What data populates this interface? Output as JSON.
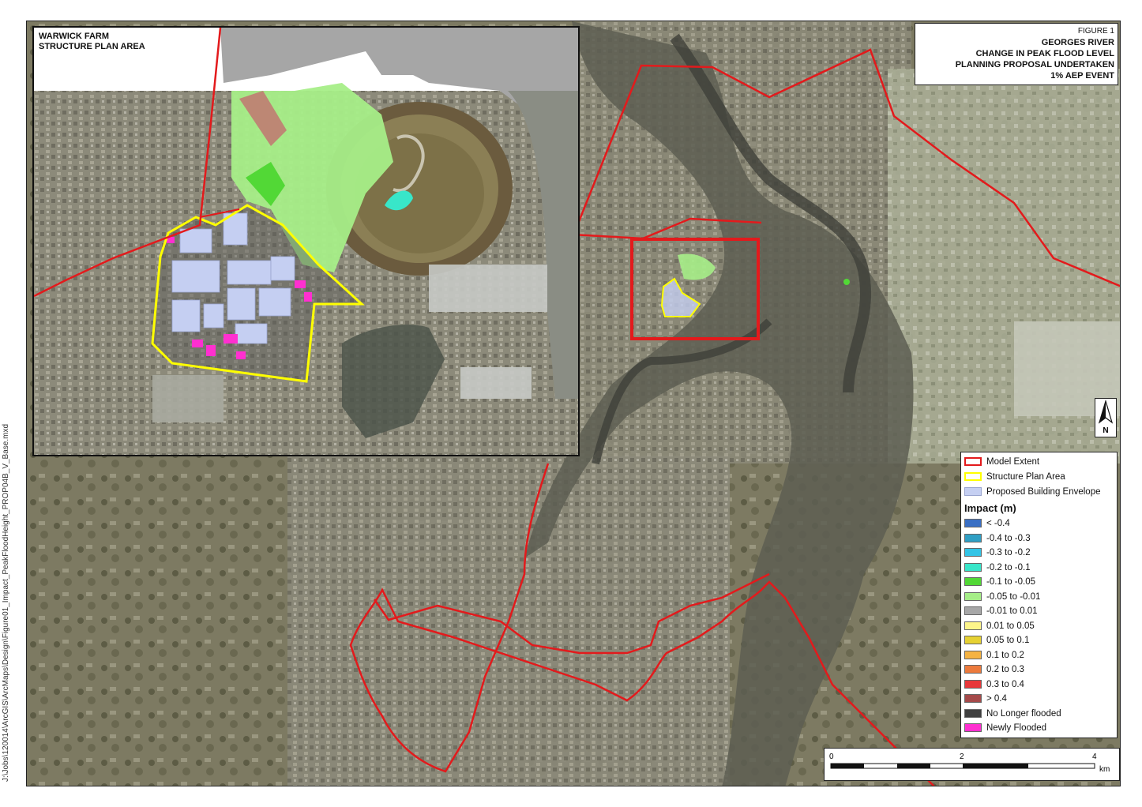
{
  "side_path": "J:\\Jobs\\120014\\ArcGIS\\ArcMaps\\Design\\Figure01_Impact_PeakFloodHeight_PROP04B_V_Base.mxd",
  "inset_title": [
    "WARWICK FARM",
    "STRUCTURE PLAN AREA"
  ],
  "figure_title": {
    "number": "FIGURE 1",
    "lines": [
      "GEORGES RIVER",
      "CHANGE IN PEAK FLOOD LEVEL",
      "PLANNING PROPOSAL UNDERTAKEN",
      "1% AEP EVENT"
    ]
  },
  "north_label": "N",
  "legend": {
    "layers": [
      {
        "label": "Model Extent",
        "style": "outline",
        "color": "#e31a1c"
      },
      {
        "label": "Structure Plan Area",
        "style": "outline",
        "color": "#ffff00"
      },
      {
        "label": "Proposed Building Envelope",
        "style": "fill",
        "color": "#c5cff2"
      }
    ],
    "heading": "Impact (m)",
    "classes": [
      {
        "label": "< -0.4",
        "color": "#3a6fc4"
      },
      {
        "label": "-0.4 to -0.3",
        "color": "#2f9fc4"
      },
      {
        "label": "-0.3 to -0.2",
        "color": "#33c4e6"
      },
      {
        "label": "-0.2 to -0.1",
        "color": "#38e6c9"
      },
      {
        "label": "-0.1 to -0.05",
        "color": "#52d836"
      },
      {
        "label": "-0.05 to -0.01",
        "color": "#a6ee88"
      },
      {
        "label": "-0.01 to 0.01",
        "color": "#a7a7a7"
      },
      {
        "label": "0.01 to 0.05",
        "color": "#fdf58a"
      },
      {
        "label": "0.05 to 0.1",
        "color": "#e6d132"
      },
      {
        "label": "0.1 to 0.2",
        "color": "#f5b342"
      },
      {
        "label": "0.2 to 0.3",
        "color": "#ec7a3c"
      },
      {
        "label": "0.3 to 0.4",
        "color": "#e8383a"
      },
      {
        "label": "> 0.4",
        "color": "#a54a4a"
      },
      {
        "label": "No Longer flooded",
        "color": "#404040"
      },
      {
        "label": "Newly Flooded",
        "color": "#ff2fd0"
      }
    ]
  },
  "scale_bar": {
    "ticks": [
      "0",
      "2",
      "4"
    ],
    "unit": "km"
  }
}
